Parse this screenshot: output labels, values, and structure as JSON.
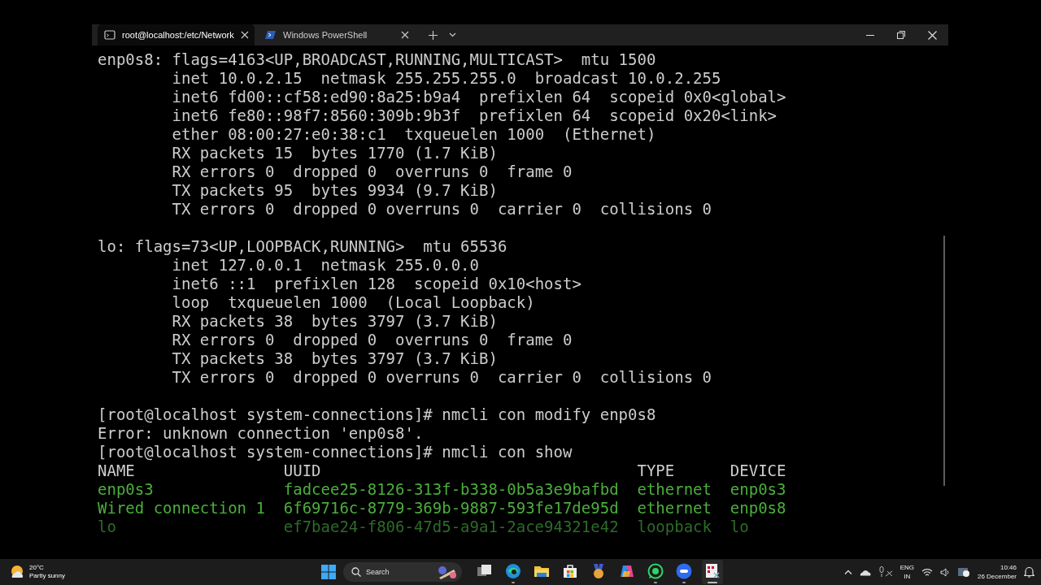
{
  "terminal_window": {
    "tabs": [
      {
        "title": "root@localhost:/etc/Network",
        "kind": "cmd",
        "selected": true
      },
      {
        "title": "Windows PowerShell",
        "kind": "powershell",
        "selected": false
      }
    ]
  },
  "output_blocks": [
    {
      "lines": [
        "enp0s8: flags=4163<UP,BROADCAST,RUNNING,MULTICAST>  mtu 1500",
        "        inet 10.0.2.15  netmask 255.255.255.0  broadcast 10.0.2.255",
        "        inet6 fd00::cf58:ed90:8a25:b9a4  prefixlen 64  scopeid 0x0<global>",
        "        inet6 fe80::98f7:8560:309b:9b3f  prefixlen 64  scopeid 0x20<link>",
        "        ether 08:00:27:e0:38:c1  txqueuelen 1000  (Ethernet)",
        "        RX packets 15  bytes 1770 (1.7 KiB)",
        "        RX errors 0  dropped 0  overruns 0  frame 0",
        "        TX packets 95  bytes 9934 (9.7 KiB)",
        "        TX errors 0  dropped 0 overruns 0  carrier 0  collisions 0"
      ]
    },
    {
      "lines": [
        "lo: flags=73<UP,LOOPBACK,RUNNING>  mtu 65536",
        "        inet 127.0.0.1  netmask 255.0.0.0",
        "        inet6 ::1  prefixlen 128  scopeid 0x10<host>",
        "        loop  txqueuelen 1000  (Local Loopback)",
        "        RX packets 38  bytes 3797 (3.7 KiB)",
        "        RX errors 0  dropped 0  overruns 0  frame 0",
        "        TX packets 38  bytes 3797 (3.7 KiB)",
        "        TX errors 0  dropped 0 overruns 0  carrier 0  collisions 0"
      ]
    },
    {
      "lines": [
        "[root@localhost system-connections]# nmcli con modify enp0s8",
        "Error: unknown connection 'enp0s8'.",
        "[root@localhost system-connections]# nmcli con show"
      ]
    }
  ],
  "connections_table": {
    "columns": [
      "NAME",
      "UUID",
      "TYPE",
      "DEVICE"
    ],
    "rows": [
      {
        "cells": [
          "enp0s3",
          "fadcee25-8126-313f-b338-0b5a3e9bafbd",
          "ethernet",
          "enp0s3"
        ],
        "active": true
      },
      {
        "cells": [
          "Wired connection 1",
          "6f69716c-8779-369b-9887-593fe17de95d",
          "ethernet",
          "enp0s8"
        ],
        "active": true
      },
      {
        "cells": [
          "lo",
          "ef7bae24-f806-47d5-a9a1-2ace94321e42",
          "loopback",
          "lo"
        ],
        "active": false
      }
    ]
  },
  "taskbar": {
    "weather": {
      "temperature": "20°C",
      "condition": "Partly sunny"
    },
    "search": {
      "label": "Search"
    },
    "apps": [
      {
        "kind": "task-view",
        "running": false,
        "focused": false
      },
      {
        "kind": "browser",
        "running": true,
        "focused": false
      },
      {
        "kind": "folder",
        "running": false,
        "focused": false
      },
      {
        "kind": "store",
        "running": false,
        "focused": false
      },
      {
        "kind": "medal",
        "running": false,
        "focused": false
      },
      {
        "kind": "copilot",
        "running": false,
        "focused": false
      },
      {
        "kind": "chat",
        "running": true,
        "focused": false
      },
      {
        "kind": "video",
        "running": true,
        "focused": false
      },
      {
        "kind": "terminal",
        "running": true,
        "focused": true
      }
    ],
    "tray": {
      "language": "ENG",
      "region": "IN",
      "time": "10:46",
      "date": "26 December"
    }
  }
}
